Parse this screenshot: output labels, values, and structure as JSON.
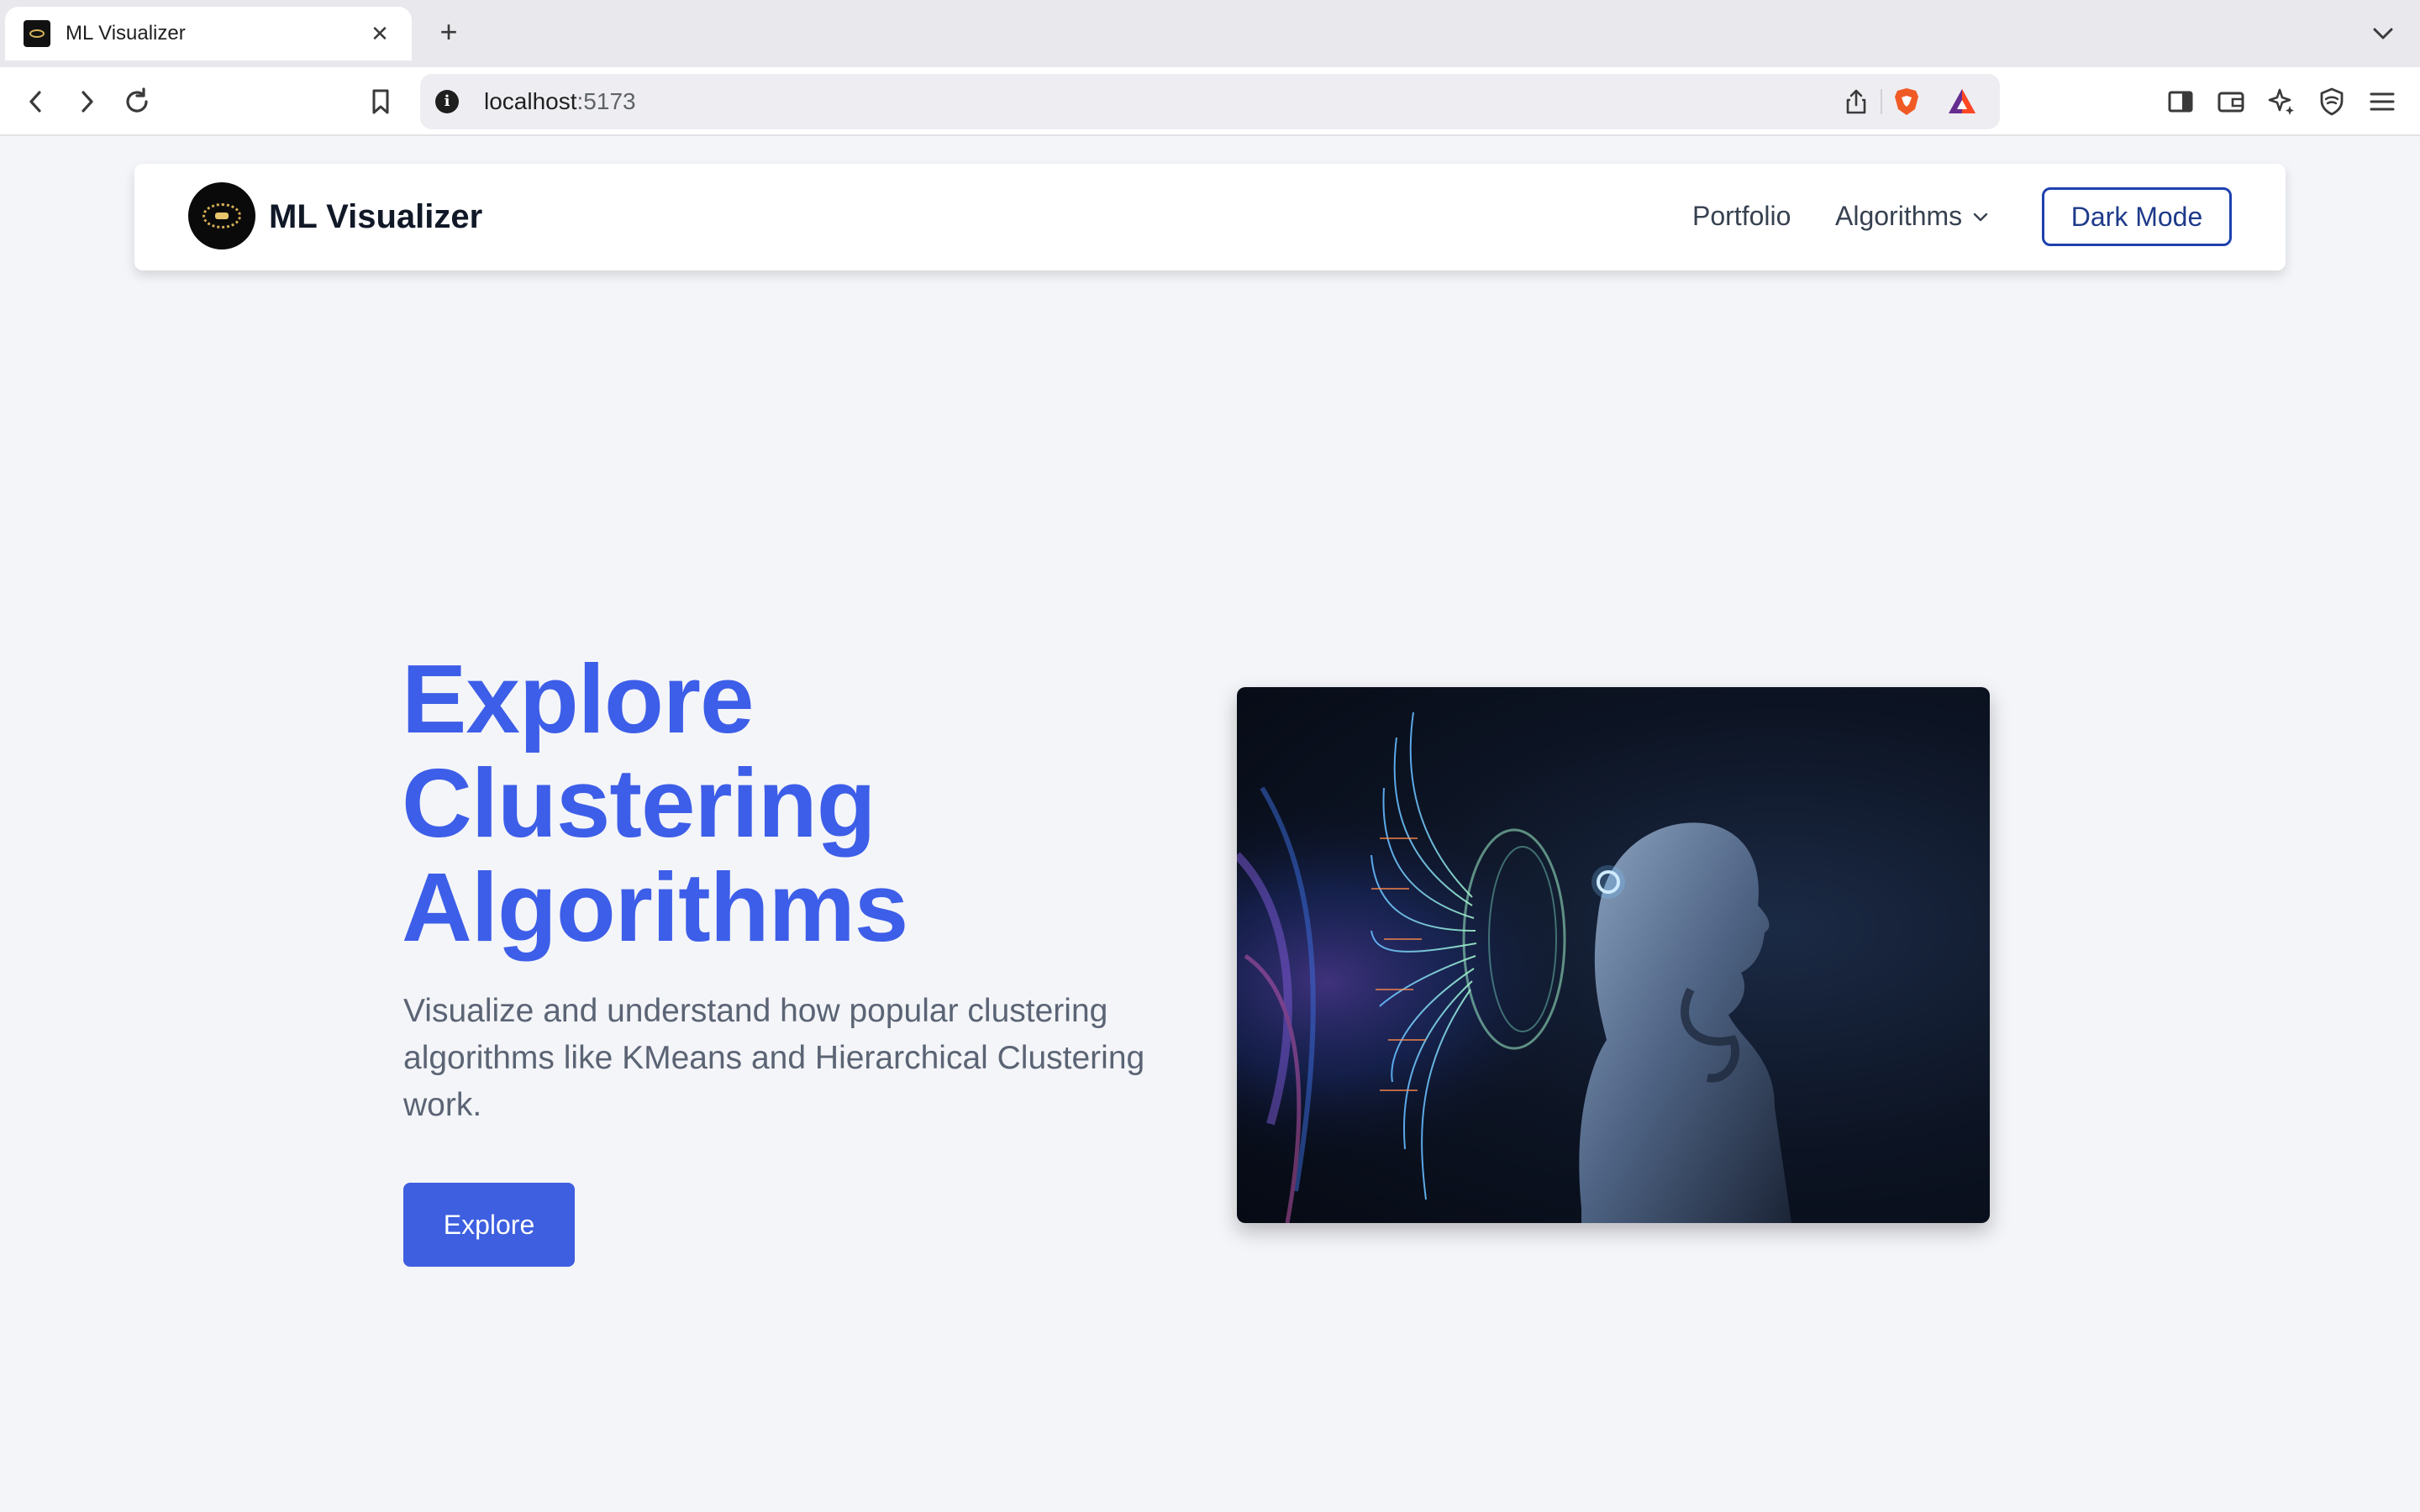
{
  "browser": {
    "tab_title": "ML Visualizer",
    "tab_close": "✕",
    "new_tab": "+",
    "url_host": "localhost",
    "url_port": ":5173",
    "site_info": "i"
  },
  "navbar": {
    "brand": "ML Visualizer",
    "links": [
      "Portfolio",
      "Algorithms"
    ],
    "dark_mode_label": "Dark Mode"
  },
  "hero": {
    "title_lines": [
      "Explore",
      "Clustering",
      "Algorithms"
    ],
    "description": "Visualize and understand how popular clustering algorithms like KMeans and Hierarchical Clustering work.",
    "cta_label": "Explore"
  },
  "colors": {
    "accent": "#3d5ee8",
    "button": "#3d5fe0",
    "dark_mode_border": "#1e40af",
    "page_bg": "#f4f5f9"
  },
  "icons": [
    "back-icon",
    "forward-icon",
    "reload-icon",
    "bookmark-icon",
    "share-icon",
    "brave-shield-icon",
    "brave-rewards-icon",
    "sidebar-icon",
    "wallet-icon",
    "leo-ai-icon",
    "vpn-icon",
    "menu-icon",
    "chevron-down-icon"
  ]
}
